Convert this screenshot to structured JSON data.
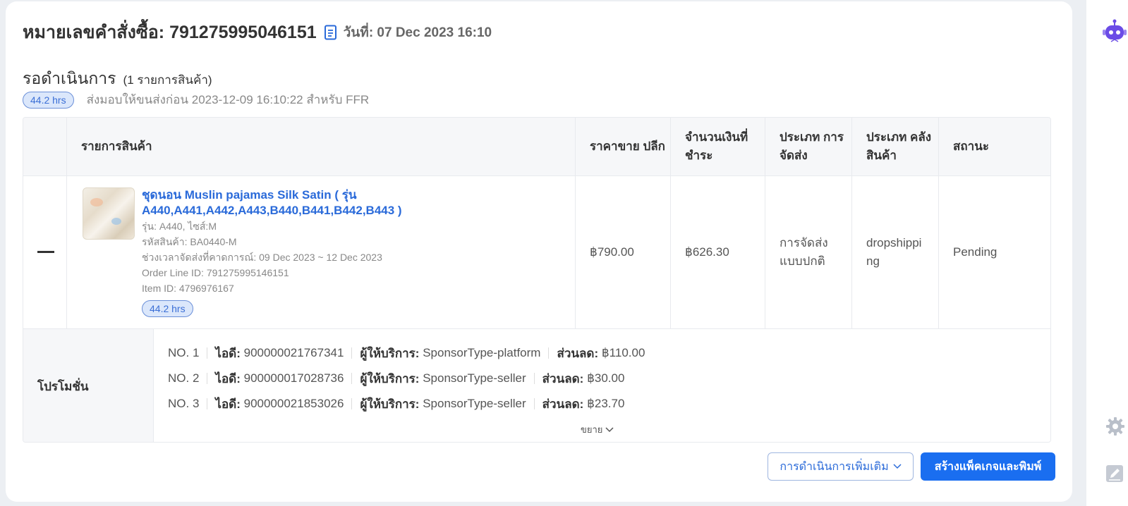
{
  "order": {
    "title": "หมายเลขคำสั่งซื้อ: 791275995046151",
    "date": "วันที่: 07 Dec 2023 16:10"
  },
  "status": {
    "title": "รอดำเนินการ",
    "count": "(1 รายการสินค้า)",
    "badge": "44.2 hrs",
    "deadline": "ส่งมอบให้ขนส่งก่อน 2023-12-09 16:10:22 สำหรับ FFR"
  },
  "table": {
    "headers": {
      "item": "รายการสินค้า",
      "retail_price": "ราคาขาย ปลีก",
      "amount_paid": "จำนวนเงินที่ ชำระ",
      "shipping_type": "ประเภท การจัดส่ง",
      "warehouse_type": "ประเภท คลังสินค้า",
      "status": "สถานะ"
    },
    "row": {
      "product_name": "ชุดนอน Muslin pajamas Silk Satin ( รุ่น A440,A441,A442,A443,B440,B441,B442,B443 )",
      "variant": "รุ่น: A440, ไซส์:M",
      "sku": "รหัสสินค้า: BA0440-M",
      "delivery_window": "ช่วงเวลาจัดส่งที่คาดการณ์: 09 Dec 2023 ~ 12 Dec 2023",
      "order_line_id": "Order Line ID: 791275995146151",
      "item_id": "Item ID: 4796976167",
      "badge": "44.2 hrs",
      "retail_price": "฿790.00",
      "amount_paid": "฿626.30",
      "shipping_type": "การจัดส่ง แบบปกติ",
      "warehouse_type": "dropshipping",
      "status": "Pending"
    }
  },
  "promotions": {
    "label": "โปรโมชั่น",
    "items": [
      {
        "no": "NO. 1",
        "id_label": "ไอดี:",
        "id": "900000021767341",
        "sponsor_label": "ผู้ให้บริการ:",
        "sponsor": "SponsorType-platform",
        "discount_label": "ส่วนลด:",
        "discount": "฿110.00"
      },
      {
        "no": "NO. 2",
        "id_label": "ไอดี:",
        "id": "900000017028736",
        "sponsor_label": "ผู้ให้บริการ:",
        "sponsor": "SponsorType-seller",
        "discount_label": "ส่วนลด:",
        "discount": "฿30.00"
      },
      {
        "no": "NO. 3",
        "id_label": "ไอดี:",
        "id": "900000021853026",
        "sponsor_label": "ผู้ให้บริการ:",
        "sponsor": "SponsorType-seller",
        "discount_label": "ส่วนลด:",
        "discount": "฿23.70"
      }
    ],
    "expand_label": "ขยาย"
  },
  "actions": {
    "more_label": "การดำเนินการเพิ่มเติม",
    "primary_label": "สร้างแพ็คเกจและพิมพ์"
  },
  "colors": {
    "accent": "#1a6ef0",
    "link": "#2a6ad9",
    "badge_bg": "#dbe7fb"
  },
  "icons": {
    "document": "document-icon",
    "robot": "robot-assistant-icon",
    "gear": "gear-icon",
    "edit": "edit-icon"
  }
}
